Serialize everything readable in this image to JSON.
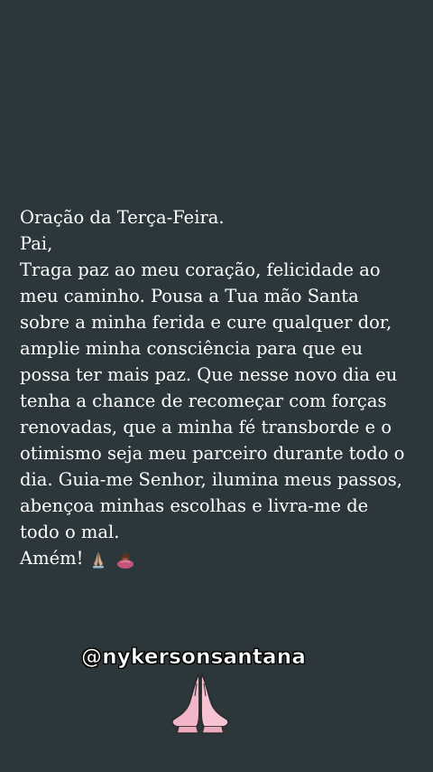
{
  "story": {
    "prayer_lines": [
      "Oração da Terça-Feira.",
      "Pai,",
      "Traga paz ao meu coração, felicidade ao",
      "meu caminho. Pousa a Tua mão Santa",
      "sobre a minha ferida e cure qualquer dor,",
      "amplie minha consciência para que eu",
      "possa ter mais paz. Que nesse novo dia eu",
      "tenha a chance de recomeçar com forças",
      "renovadas, que a minha fé transborde e o",
      "otimismo seja meu parceiro durante todo o",
      "dia. Guia-me Senhor, ilumina meus passos,",
      "abençoa minhas escolhas e livra-me de",
      "todo o mal."
    ],
    "amen": "Amém!",
    "amen_emojis": [
      "praying-hands-icon",
      "person-bowing-icon"
    ],
    "handle": "@nykersonsantana",
    "sticker": "praying-hands-sticker-icon"
  },
  "colors": {
    "background": "#2c373b",
    "text": "#ffffff",
    "handle_outline": "#000000",
    "sticker_fill": "#f2b6c8"
  }
}
